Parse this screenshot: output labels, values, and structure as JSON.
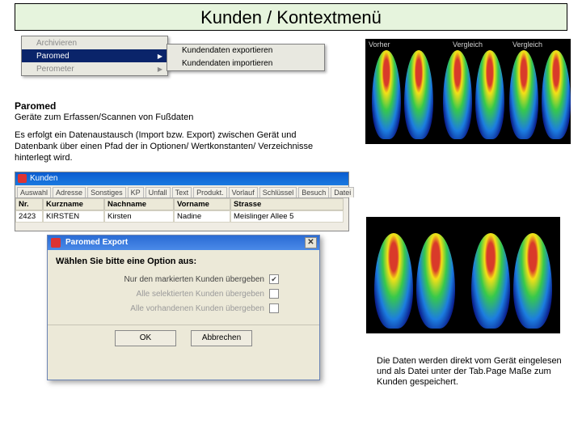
{
  "title": "Kunden / Kontextmenü",
  "context_menu": {
    "archivieren": "Archivieren",
    "paromed": "Paromed",
    "perometer": "Perometer",
    "sub_export": "Kundendaten exportieren",
    "sub_import": "Kundendaten importieren"
  },
  "text": {
    "heading": "Paromed",
    "sub": "Geräte zum Erfassen/Scannen von Fußdaten",
    "para": "Es erfolgt ein Datenaustausch (Import bzw. Export) zwischen Gerät und Datenbank über einen Pfad der in Optionen/ Wertkonstanten/ Verzeichnisse hinterlegt wird.",
    "footer": "Die Daten werden direkt vom Gerät eingelesen und als Datei unter der Tab.Page Maße zum Kunden gespeichert."
  },
  "kunden_win": {
    "title": "Kunden",
    "tabs": [
      "Auswahl",
      "Adresse",
      "Sonstiges",
      "KP",
      "Unfall",
      "Text",
      "Produkt.",
      "Vorlauf",
      "Schlüssel",
      "Besuch",
      "Datei"
    ],
    "headers": [
      "Nr.",
      "Kurzname",
      "Nachname",
      "Vorname",
      "Strasse"
    ],
    "row": [
      "2423",
      "KIRSTEN",
      "Kirsten",
      "Nadine",
      "Meislinger Allee 5"
    ]
  },
  "dialog": {
    "title": "Paromed   Export",
    "header": "Wählen Sie bitte eine Option aus:",
    "opt1": "Nur den markierten Kunden übergeben",
    "opt2": "Alle selektierten Kunden übergeben",
    "opt3": "Alle vorhandenen Kunden übergeben",
    "ok": "OK",
    "cancel": "Abbrechen"
  },
  "scan_labels": {
    "vergleich": "Vergleich",
    "vorher": "Vorher"
  }
}
